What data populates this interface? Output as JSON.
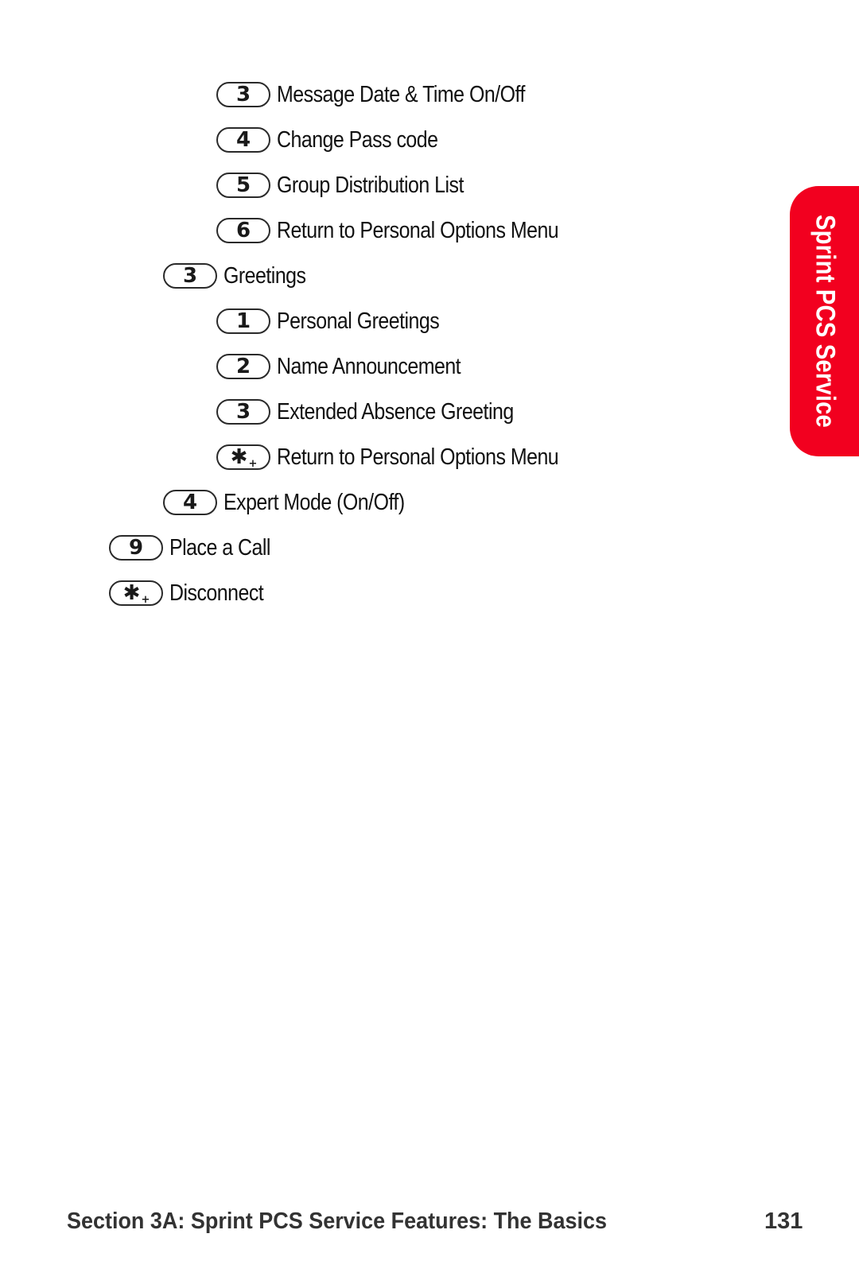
{
  "menu": {
    "items": [
      {
        "key": "3",
        "label": "Message Date & Time On/Off",
        "level": 3
      },
      {
        "key": "4",
        "label": "Change Pass code",
        "level": 3
      },
      {
        "key": "5",
        "label": "Group Distribution List",
        "level": 3
      },
      {
        "key": "6",
        "label": "Return to Personal Options Menu",
        "level": 3
      },
      {
        "key": "3",
        "label": "Greetings",
        "level": 2
      },
      {
        "key": "1",
        "label": "Personal Greetings",
        "level": 3
      },
      {
        "key": "2",
        "label": "Name Announcement",
        "level": 3
      },
      {
        "key": "3",
        "label": "Extended Absence Greeting",
        "level": 3
      },
      {
        "key": "✱",
        "key_sub": "+",
        "label": "Return to Personal Options Menu",
        "level": 3
      },
      {
        "key": "4",
        "label": "Expert Mode (On/Off)",
        "level": 2
      },
      {
        "key": "9",
        "label": "Place a Call",
        "level": 1
      },
      {
        "key": "✱",
        "key_sub": "+",
        "label": "Disconnect",
        "level": 1
      }
    ]
  },
  "side_tab": {
    "label": "Sprint PCS Service",
    "color": "#f2001f"
  },
  "footer": {
    "section_title": "Section 3A: Sprint PCS Service Features: The Basics",
    "page_number": "131"
  }
}
